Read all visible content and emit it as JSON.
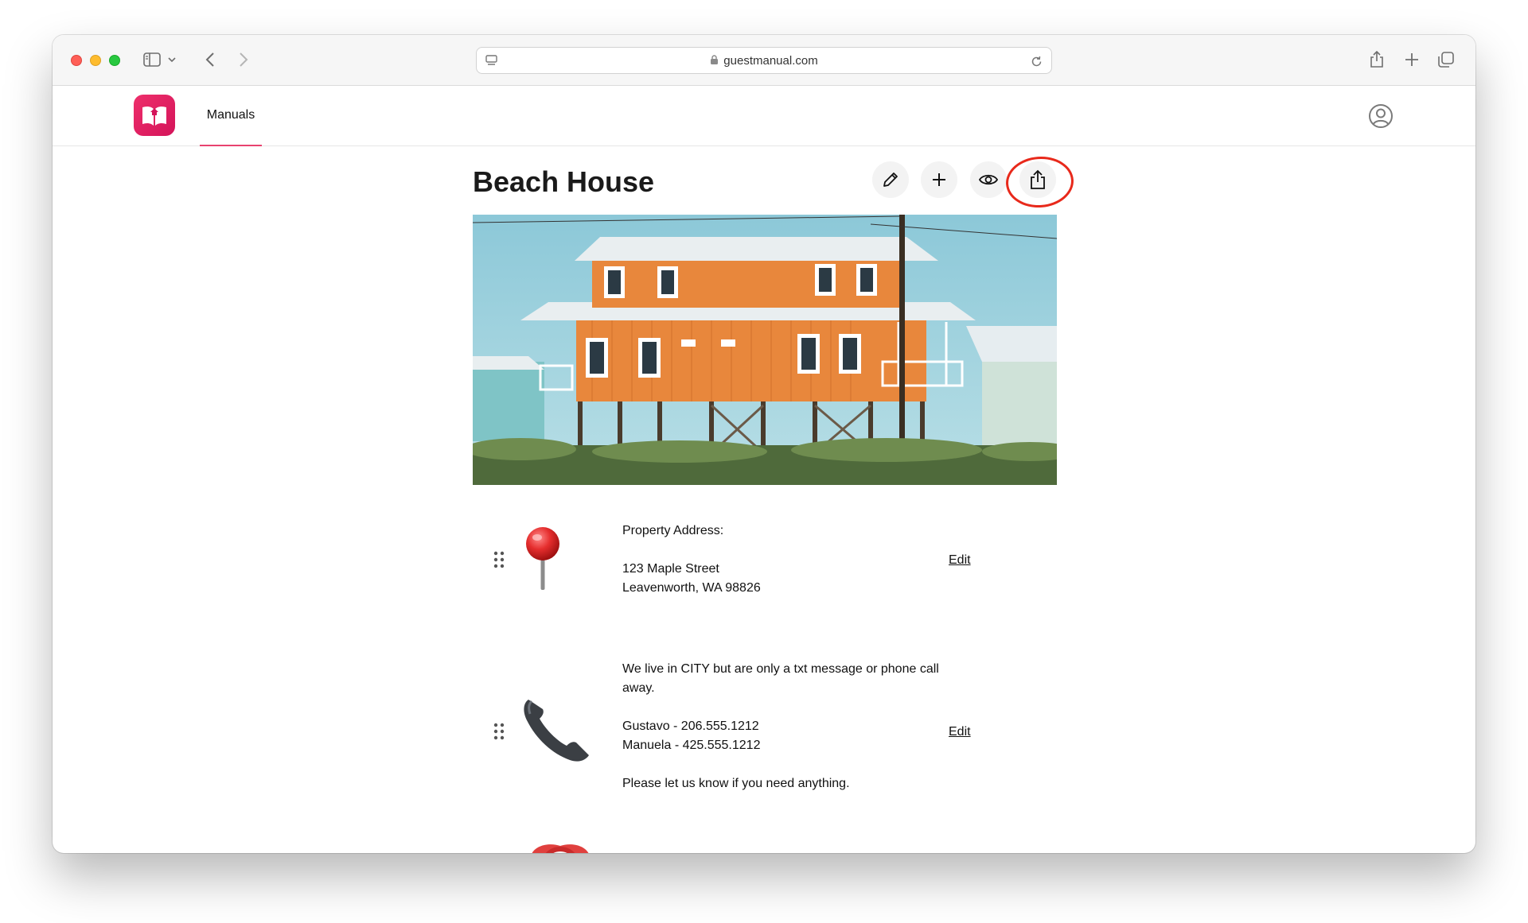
{
  "browser": {
    "url": "guestmanual.com"
  },
  "app": {
    "nav_tab": "Manuals"
  },
  "manual": {
    "title": "Beach House"
  },
  "sections": [
    {
      "icon": "pushpin-icon",
      "lines": [
        "Property Address:",
        "",
        "123 Maple Street",
        "Leavenworth, WA 98826"
      ],
      "edit_label": "Edit"
    },
    {
      "icon": "telephone-receiver-icon",
      "lines": [
        "We live in CITY but are only a txt message or phone call",
        "away.",
        "",
        "Gustavo - 206.555.1212",
        "Manuela - 425.555.1212",
        "",
        "Please let us know if you need anything."
      ],
      "edit_label": "Edit"
    },
    {
      "icon": "alarm-clock-icon"
    }
  ],
  "colors": {
    "brand": "#e8436f",
    "highlight": "#e8291b"
  }
}
